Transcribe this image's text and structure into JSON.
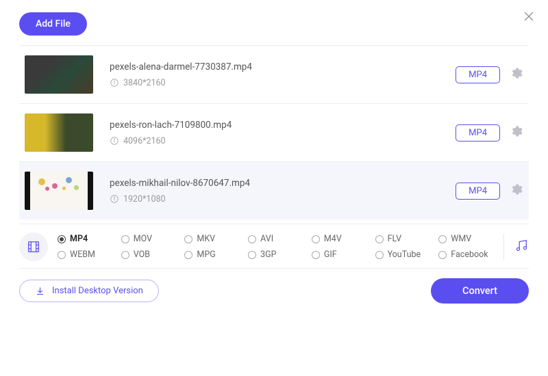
{
  "header": {
    "add_file": "Add File"
  },
  "files": [
    {
      "name": "pexels-alena-darmel-7730387.mp4",
      "resolution": "3840*2160",
      "format": "MP4",
      "hovered": false,
      "thumb": "thumb-1"
    },
    {
      "name": "pexels-ron-lach-7109800.mp4",
      "resolution": "4096*2160",
      "format": "MP4",
      "hovered": false,
      "thumb": "thumb-2"
    },
    {
      "name": "pexels-mikhail-nilov-8670647.mp4",
      "resolution": "1920*1080",
      "format": "MP4",
      "hovered": true,
      "thumb": "thumb-3"
    }
  ],
  "formats": {
    "row1": [
      "MP4",
      "MOV",
      "MKV",
      "AVI",
      "M4V",
      "FLV",
      "WMV"
    ],
    "row2": [
      "WEBM",
      "VOB",
      "MPG",
      "3GP",
      "GIF",
      "YouTube",
      "Facebook"
    ],
    "selected": "MP4"
  },
  "footer": {
    "install": "Install Desktop Version",
    "convert": "Convert"
  }
}
